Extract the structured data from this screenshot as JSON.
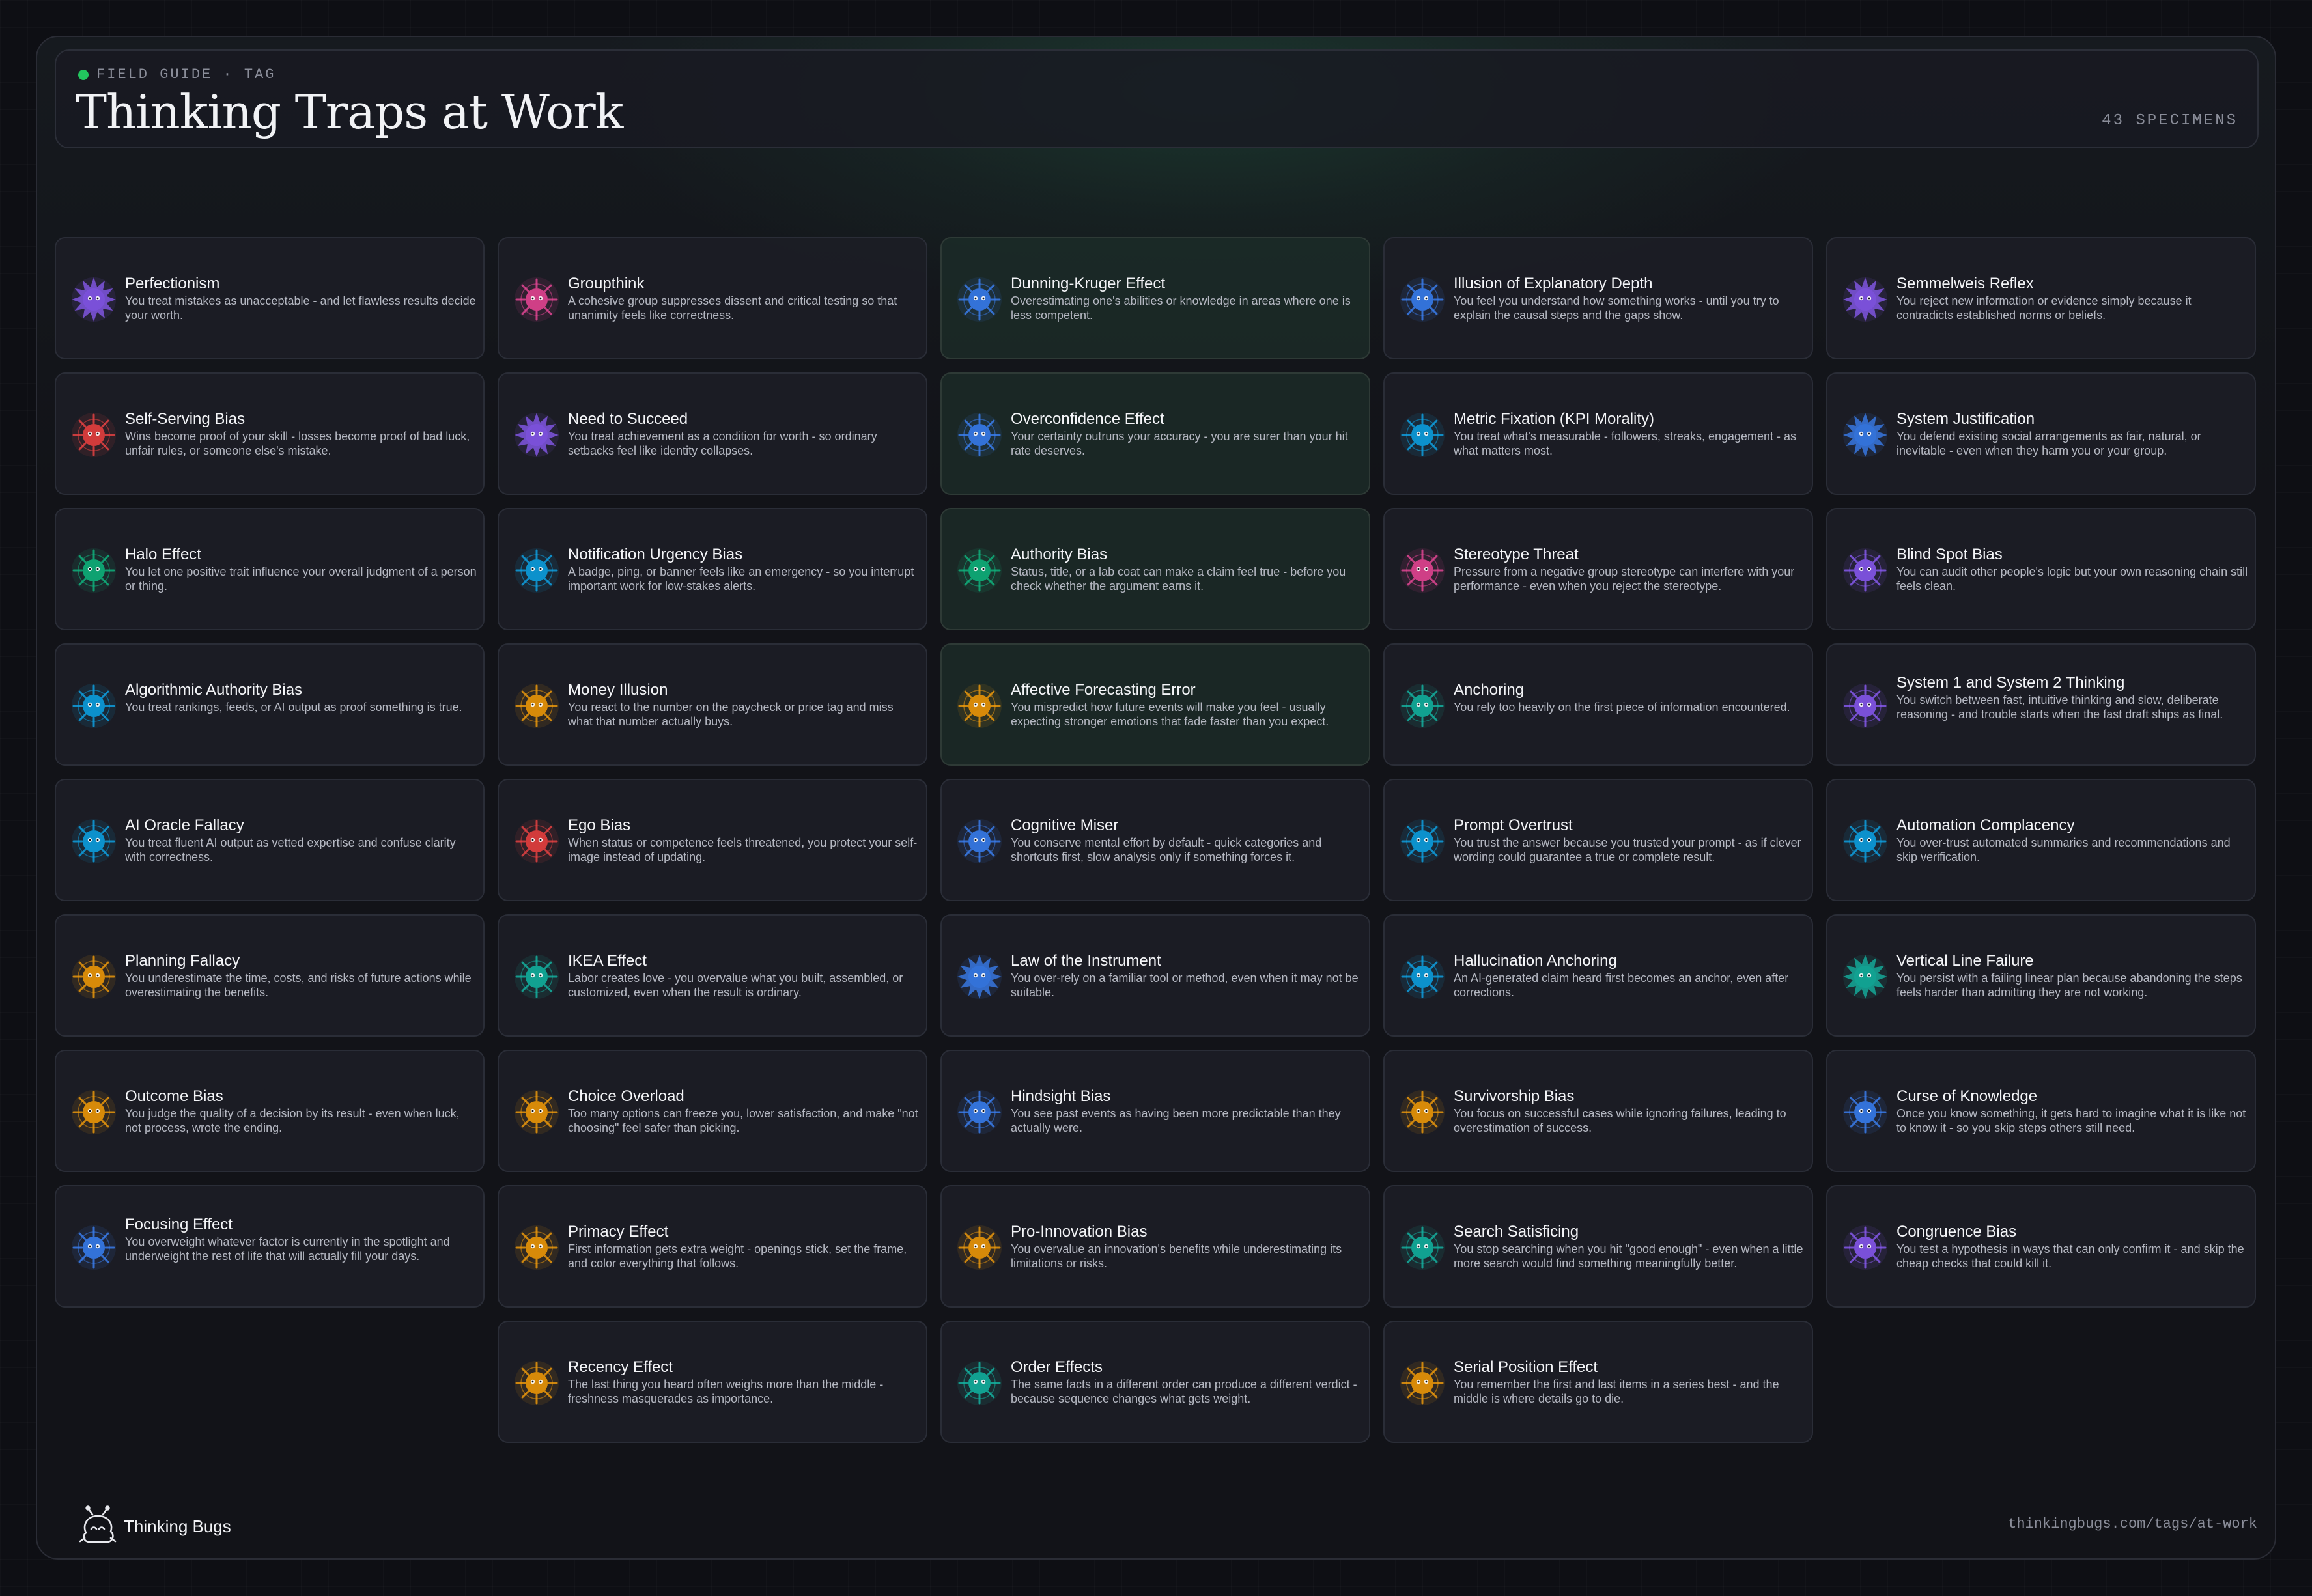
{
  "header": {
    "eyebrow": "FIELD GUIDE · TAG",
    "title": "Thinking Traps at Work",
    "count": "43 SPECIMENS",
    "status_dot_color": "#22c55e"
  },
  "palette": {
    "purple": "#8b5cf6",
    "pink": "#ec4899",
    "blue": "#3b82f6",
    "red": "#ef4444",
    "green": "#10b981",
    "sky": "#0ea5e9",
    "gold": "#f59e0b",
    "teal": "#14b8a6"
  },
  "cards": [
    {
      "title": "Perfectionism",
      "desc": "You treat mistakes as unacceptable - and let flawless results decide your worth.",
      "color": "purple",
      "icon": "spiky-bug-icon"
    },
    {
      "title": "Groupthink",
      "desc": "A cohesive group suppresses dissent and critical testing so that unanimity feels like correctness.",
      "color": "pink",
      "icon": "round-bug-icon"
    },
    {
      "title": "Dunning-Kruger Effect",
      "desc": "Overestimating one's abilities or knowledge in areas where one is less competent.",
      "color": "blue",
      "icon": "round-bug-icon",
      "tint": true
    },
    {
      "title": "Illusion of Explanatory Depth",
      "desc": "You feel you understand how something works - until you try to explain the causal steps and the gaps show.",
      "color": "blue",
      "icon": "round-bug-icon"
    },
    {
      "title": "Semmelweis Reflex",
      "desc": "You reject new information or evidence simply because it contradicts established norms or beliefs.",
      "color": "purple",
      "icon": "spiky-bug-icon"
    },
    {
      "title": "Self-Serving Bias",
      "desc": "Wins become proof of your skill - losses become proof of bad luck, unfair rules, or someone else's mistake.",
      "color": "red",
      "icon": "round-bug-icon"
    },
    {
      "title": "Need to Succeed",
      "desc": "You treat achievement as a condition for worth - so ordinary setbacks feel like identity collapses.",
      "color": "purple",
      "icon": "spiky-bug-icon"
    },
    {
      "title": "Overconfidence Effect",
      "desc": "Your certainty outruns your accuracy - you are surer than your hit rate deserves.",
      "color": "blue",
      "icon": "round-bug-icon",
      "tint": true
    },
    {
      "title": "Metric Fixation (KPI Morality)",
      "desc": "You treat what's measurable - followers, streaks, engagement - as what matters most.",
      "color": "sky",
      "icon": "round-bug-icon"
    },
    {
      "title": "System Justification",
      "desc": "You defend existing social arrangements as fair, natural, or inevitable - even when they harm you or your group.",
      "color": "blue",
      "icon": "spiky-bug-icon"
    },
    {
      "title": "Halo Effect",
      "desc": "You let one positive trait influence your overall judgment of a person or thing.",
      "color": "green",
      "icon": "round-bug-icon"
    },
    {
      "title": "Notification Urgency Bias",
      "desc": "A badge, ping, or banner feels like an emergency - so you interrupt important work for low-stakes alerts.",
      "color": "sky",
      "icon": "round-bug-icon"
    },
    {
      "title": "Authority Bias",
      "desc": "Status, title, or a lab coat can make a claim feel true - before you check whether the argument earns it.",
      "color": "green",
      "icon": "round-bug-icon",
      "tint": true
    },
    {
      "title": "Stereotype Threat",
      "desc": "Pressure from a negative group stereotype can interfere with your performance - even when you reject the stereotype.",
      "color": "pink",
      "icon": "round-bug-icon"
    },
    {
      "title": "Blind Spot Bias",
      "desc": "You can audit other people's logic but your own reasoning chain still feels clean.",
      "color": "purple",
      "icon": "round-bug-icon"
    },
    {
      "title": "Algorithmic Authority Bias",
      "desc": "You treat rankings, feeds, or AI output as proof something is true.",
      "color": "sky",
      "icon": "round-bug-icon"
    },
    {
      "title": "Money Illusion",
      "desc": "You react to the number on the paycheck or price tag and miss what that number actually buys.",
      "color": "gold",
      "icon": "round-bug-icon"
    },
    {
      "title": "Affective Forecasting Error",
      "desc": "You mispredict how future events will make you feel - usually expecting stronger emotions that fade faster than you expect.",
      "color": "gold",
      "icon": "round-bug-icon",
      "tint": true
    },
    {
      "title": "Anchoring",
      "desc": "You rely too heavily on the first piece of information encountered.",
      "color": "teal",
      "icon": "round-bug-icon"
    },
    {
      "title": "System 1 and System 2 Thinking",
      "desc": "You switch between fast, intuitive thinking and slow, deliberate reasoning - and trouble starts when the fast draft ships as final.",
      "color": "purple",
      "icon": "round-bug-icon"
    },
    {
      "title": "AI Oracle Fallacy",
      "desc": "You treat fluent AI output as vetted expertise and confuse clarity with correctness.",
      "color": "sky",
      "icon": "round-bug-icon"
    },
    {
      "title": "Ego Bias",
      "desc": "When status or competence feels threatened, you protect your self-image instead of updating.",
      "color": "red",
      "icon": "round-bug-icon"
    },
    {
      "title": "Cognitive Miser",
      "desc": "You conserve mental effort by default - quick categories and shortcuts first, slow analysis only if something forces it.",
      "color": "blue",
      "icon": "round-bug-icon"
    },
    {
      "title": "Prompt Overtrust",
      "desc": "You trust the answer because you trusted your prompt - as if clever wording could guarantee a true or complete result.",
      "color": "sky",
      "icon": "round-bug-icon"
    },
    {
      "title": "Automation Complacency",
      "desc": "You over-trust automated summaries and recommendations and skip verification.",
      "color": "sky",
      "icon": "round-bug-icon"
    },
    {
      "title": "Planning Fallacy",
      "desc": "You underestimate the time, costs, and risks of future actions while overestimating the benefits.",
      "color": "gold",
      "icon": "round-bug-icon"
    },
    {
      "title": "IKEA Effect",
      "desc": "Labor creates love - you overvalue what you built, assembled, or customized, even when the result is ordinary.",
      "color": "teal",
      "icon": "round-bug-icon"
    },
    {
      "title": "Law of the Instrument",
      "desc": "You over-rely on a familiar tool or method, even when it may not be suitable.",
      "color": "blue",
      "icon": "spiky-bug-icon"
    },
    {
      "title": "Hallucination Anchoring",
      "desc": "An AI-generated claim heard first becomes an anchor, even after corrections.",
      "color": "sky",
      "icon": "round-bug-icon"
    },
    {
      "title": "Vertical Line Failure",
      "desc": "You persist with a failing linear plan because abandoning the steps feels harder than admitting they are not working.",
      "color": "teal",
      "icon": "spiky-bug-icon"
    },
    {
      "title": "Outcome Bias",
      "desc": "You judge the quality of a decision by its result - even when luck, not process, wrote the ending.",
      "color": "gold",
      "icon": "round-bug-icon"
    },
    {
      "title": "Choice Overload",
      "desc": "Too many options can freeze you, lower satisfaction, and make \"not choosing\" feel safer than picking.",
      "color": "gold",
      "icon": "round-bug-icon"
    },
    {
      "title": "Hindsight Bias",
      "desc": "You see past events as having been more predictable than they actually were.",
      "color": "blue",
      "icon": "round-bug-icon"
    },
    {
      "title": "Survivorship Bias",
      "desc": "You focus on successful cases while ignoring failures, leading to overestimation of success.",
      "color": "gold",
      "icon": "round-bug-icon"
    },
    {
      "title": "Curse of Knowledge",
      "desc": "Once you know something, it gets hard to imagine what it is like not to know it - so you skip steps others still need.",
      "color": "blue",
      "icon": "round-bug-icon"
    },
    {
      "title": "Focusing Effect",
      "desc": "You overweight whatever factor is currently in the spotlight and underweight the rest of life that will actually fill your days.",
      "color": "blue",
      "icon": "round-bug-icon"
    },
    {
      "title": "Primacy Effect",
      "desc": "First information gets extra weight - openings stick, set the frame, and color everything that follows.",
      "color": "gold",
      "icon": "round-bug-icon"
    },
    {
      "title": "Pro-Innovation Bias",
      "desc": "You overvalue an innovation's benefits while underestimating its limitations or risks.",
      "color": "gold",
      "icon": "round-bug-icon"
    },
    {
      "title": "Search Satisficing",
      "desc": "You stop searching when you hit \"good enough\" - even when a little more search would find something meaningfully better.",
      "color": "teal",
      "icon": "round-bug-icon"
    },
    {
      "title": "Congruence Bias",
      "desc": "You test a hypothesis in ways that can only confirm it - and skip the cheap checks that could kill it.",
      "color": "purple",
      "icon": "round-bug-icon"
    },
    {
      "title": "Recency Effect",
      "desc": "The last thing you heard often weighs more than the middle - freshness masquerades as importance.",
      "color": "gold",
      "icon": "round-bug-icon"
    },
    {
      "title": "Order Effects",
      "desc": "The same facts in a different order can produce a different verdict - because sequence changes what gets weight.",
      "color": "teal",
      "icon": "round-bug-icon"
    },
    {
      "title": "Serial Position Effect",
      "desc": "You remember the first and last items in a series best - and the middle is where details go to die.",
      "color": "gold",
      "icon": "round-bug-icon"
    }
  ],
  "footer": {
    "brand": "Thinking Bugs",
    "url": "thinkingbugs.com/tags/at-work",
    "logo_icon": "bug-outline-logo-icon"
  }
}
